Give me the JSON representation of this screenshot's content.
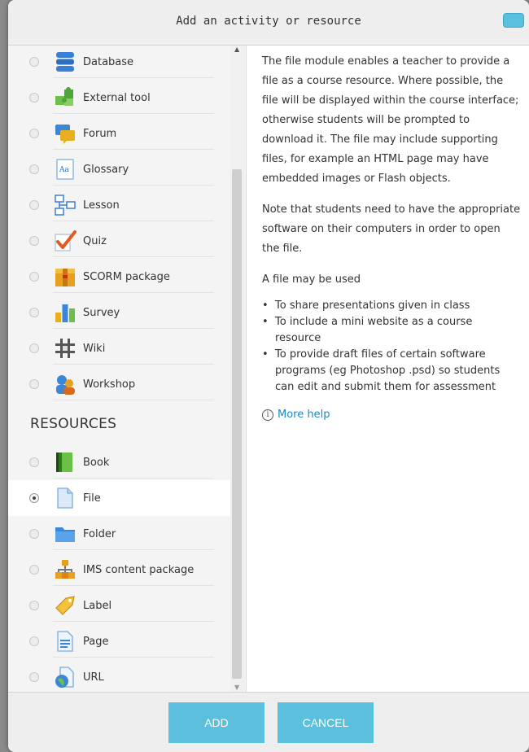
{
  "dialog": {
    "title": "Add an activity or resource"
  },
  "activities": [
    {
      "label": "Database",
      "icon": "database-icon"
    },
    {
      "label": "External tool",
      "icon": "puzzle-icon"
    },
    {
      "label": "Forum",
      "icon": "forum-icon"
    },
    {
      "label": "Glossary",
      "icon": "glossary-icon"
    },
    {
      "label": "Lesson",
      "icon": "lesson-icon"
    },
    {
      "label": "Quiz",
      "icon": "quiz-icon"
    },
    {
      "label": "SCORM package",
      "icon": "scorm-icon"
    },
    {
      "label": "Survey",
      "icon": "survey-icon"
    },
    {
      "label": "Wiki",
      "icon": "wiki-icon"
    },
    {
      "label": "Workshop",
      "icon": "workshop-icon"
    }
  ],
  "resources_heading": "RESOURCES",
  "resources": [
    {
      "label": "Book",
      "icon": "book-icon"
    },
    {
      "label": "File",
      "icon": "file-icon",
      "selected": true
    },
    {
      "label": "Folder",
      "icon": "folder-icon"
    },
    {
      "label": "IMS content package",
      "icon": "ims-icon"
    },
    {
      "label": "Label",
      "icon": "label-icon"
    },
    {
      "label": "Page",
      "icon": "page-icon"
    },
    {
      "label": "URL",
      "icon": "url-icon"
    }
  ],
  "description": {
    "p1": "The file module enables a teacher to provide a file as a course resource. Where possible, the file will be displayed within the course interface; otherwise students will be prompted to download it. The file may include supporting files, for example an HTML page may have embedded images or Flash objects.",
    "p2": "Note that students need to have the appropriate software on their computers in order to open the file.",
    "p3": "A file may be used",
    "bullets": [
      "To share presentations given in class",
      "To include a mini website as a course resource",
      "To provide draft files of certain software programs (eg Photoshop .psd) so students can edit and submit them for assessment"
    ],
    "more_help": "More help",
    "info_glyph": "i"
  },
  "footer": {
    "add_label": "ADD",
    "cancel_label": "CANCEL"
  },
  "colors": {
    "accent": "#5bc0de",
    "link": "#1a88c9"
  }
}
